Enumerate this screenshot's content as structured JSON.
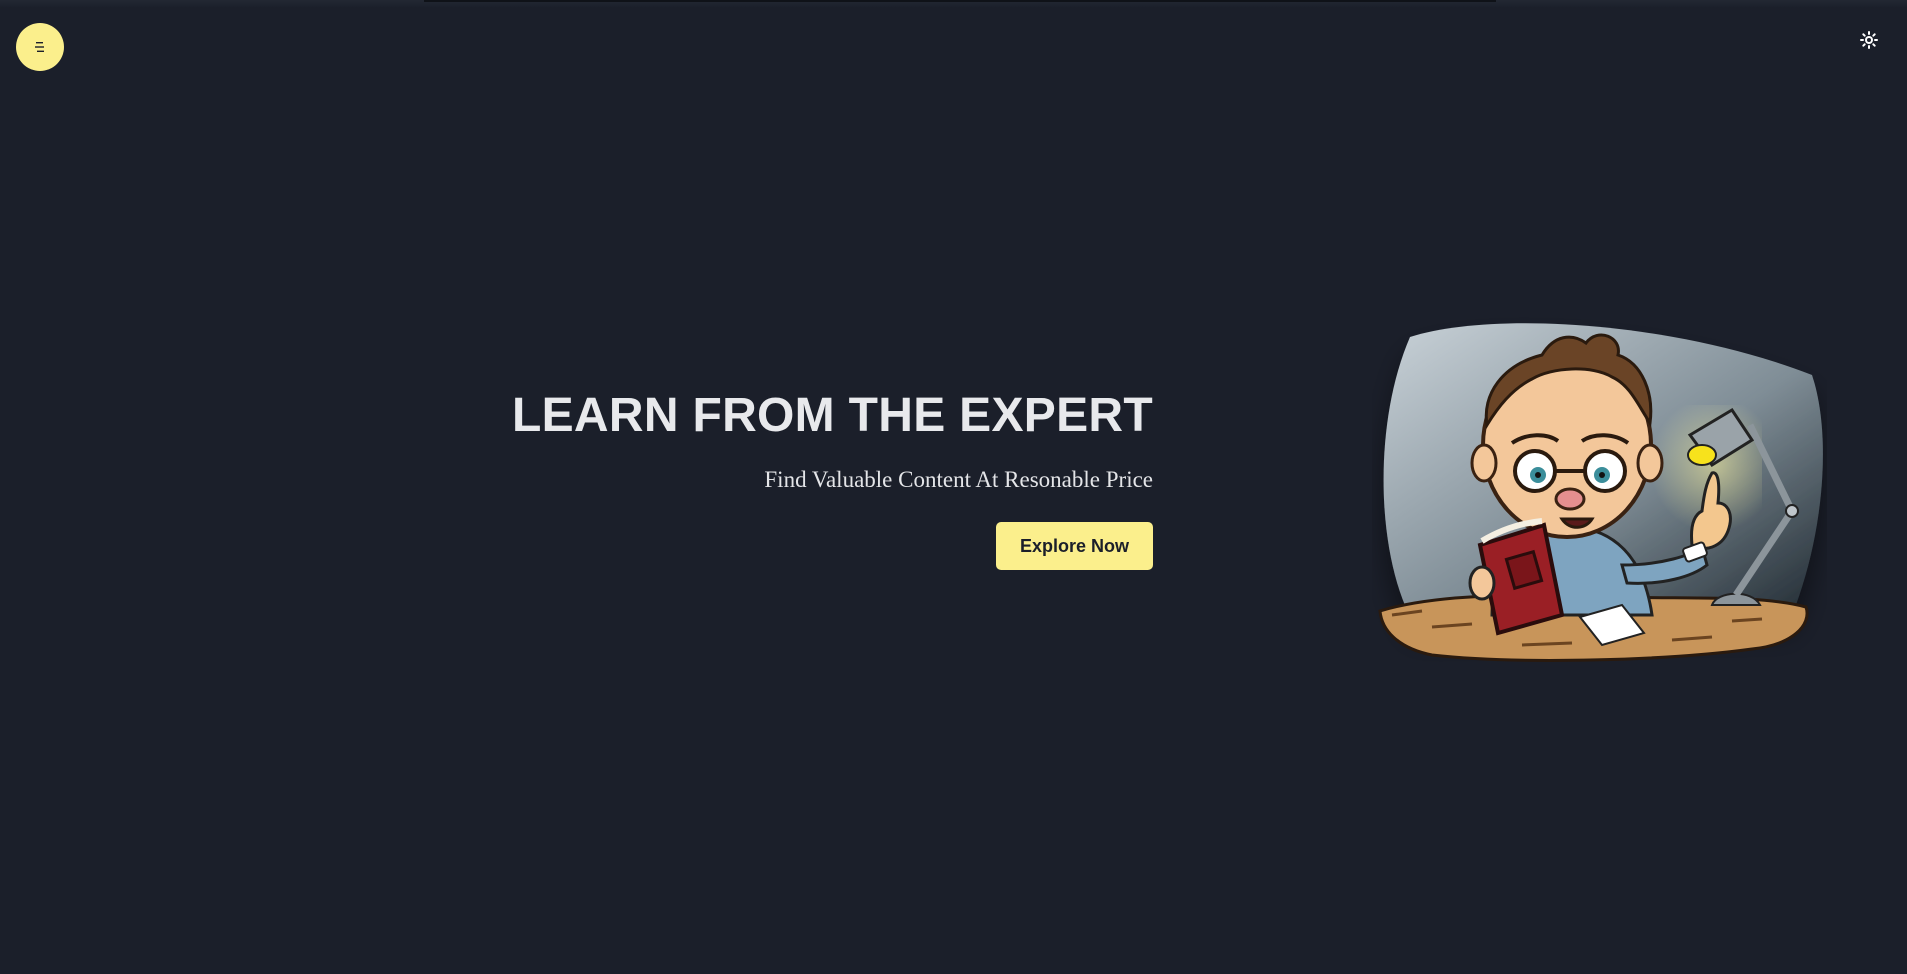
{
  "header": {
    "menu_icon": "menu-icon",
    "theme_icon": "sun-icon"
  },
  "hero": {
    "title": "LEARN FROM THE EXPERT",
    "subtitle": "Find Valuable Content At Resonable Price",
    "cta_label": "Explore Now",
    "illustration": "cartoon-professor-reading-illustration"
  },
  "colors": {
    "background": "#1b1f2a",
    "accent": "#fbef8c",
    "text": "#e8e9ec"
  }
}
